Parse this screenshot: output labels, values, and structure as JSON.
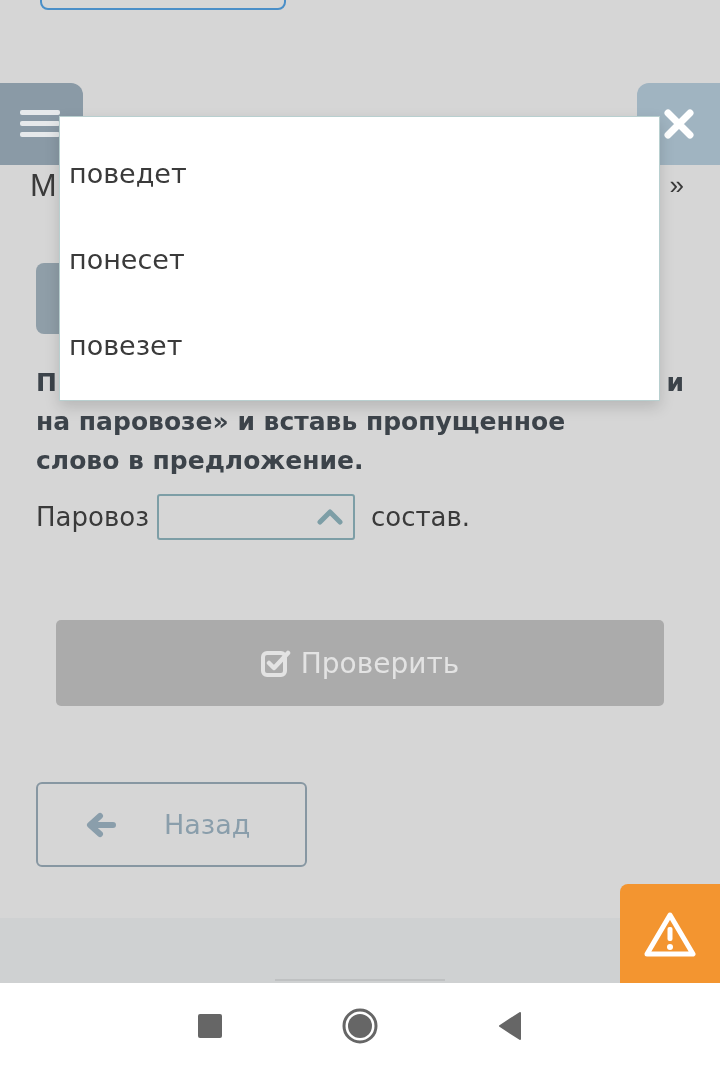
{
  "title": {
    "left": "М",
    "right": "»"
  },
  "instruction": {
    "line_start": "П",
    "line_end": "и",
    "rest": "на паровозе» и вставь пропущенное слово в предложение."
  },
  "sentence": {
    "before": "Паровоз",
    "after": "состав.",
    "select": {
      "expanded": true
    }
  },
  "dropdown": {
    "options": [
      {
        "label": "поведет",
        "selected": false
      },
      {
        "label": "понесет",
        "selected": false
      },
      {
        "label": "повезет",
        "selected": false
      }
    ]
  },
  "check_button": {
    "label": "Проверить",
    "disabled": true
  },
  "back_button": {
    "label": "Назад"
  }
}
